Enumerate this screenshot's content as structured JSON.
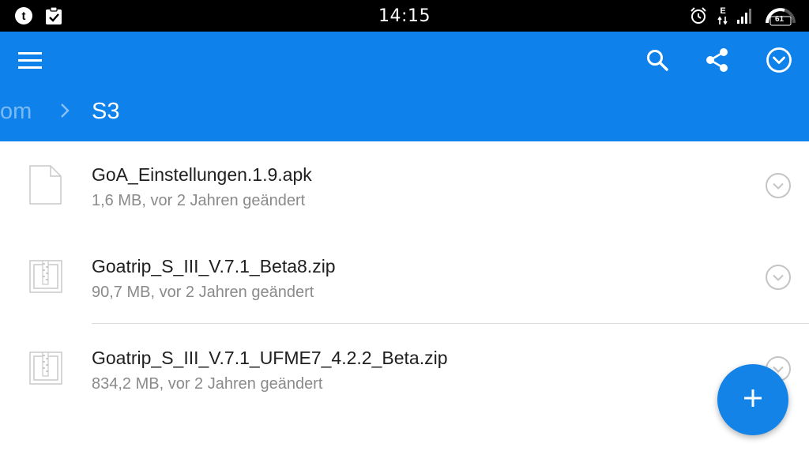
{
  "status_bar": {
    "time": "14:15",
    "network_type": "E",
    "battery_level": "61",
    "left_icons": [
      "tumblr-notification-icon",
      "clipboard-check-notification-icon"
    ],
    "right_icons": [
      "alarm-icon",
      "data-arrows-icon",
      "signal-bars-icon",
      "battery-speedometer-icon"
    ]
  },
  "toolbar": {
    "menu_icon": "hamburger-menu-icon",
    "actions": [
      "search-icon",
      "share-icon",
      "select-all-icon"
    ]
  },
  "breadcrumb": {
    "previous": "om",
    "separator_icon": "chevron-right-icon",
    "current": "S3"
  },
  "files": [
    {
      "name": "GoA_Einstellungen.1.9.apk",
      "meta": "1,6 MB, vor 2 Jahren geändert",
      "icon": "generic-file-icon"
    },
    {
      "name": "Goatrip_S_III_V.7.1_Beta8.zip",
      "meta": "90,7 MB, vor 2 Jahren geändert",
      "icon": "zip-archive-icon"
    },
    {
      "name": "Goatrip_S_III_V.7.1_UFME7_4.2.2_Beta.zip",
      "meta": "834,2 MB, vor 2 Jahren geändert",
      "icon": "zip-archive-icon"
    }
  ],
  "fab": {
    "icon": "plus-icon"
  },
  "colors": {
    "app_bar": "#0e82ea",
    "fab": "#1483e8",
    "status_bar": "#000000",
    "primary_text": "#202020",
    "secondary_text": "#8a8a8a"
  }
}
